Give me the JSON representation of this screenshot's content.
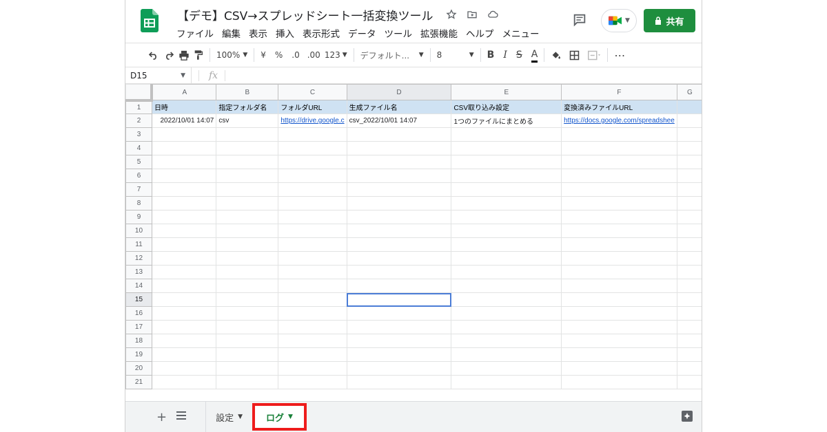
{
  "app": {
    "doc_title": "【デモ】CSV→スプレッドシート一括変換ツール",
    "menu": [
      "ファイル",
      "編集",
      "表示",
      "挿入",
      "表示形式",
      "データ",
      "ツール",
      "拡張機能",
      "ヘルプ",
      "メニュー"
    ],
    "share_label": "共有"
  },
  "toolbar": {
    "zoom": "100%",
    "currency": "¥",
    "percent": "%",
    "dec_decrease": ".0",
    "dec_increase": ".00",
    "number_format": "123",
    "font_name": "デフォルト...",
    "font_size": "8",
    "bold": "B",
    "italic": "I",
    "strike": "S",
    "text_color": "A",
    "more": "⋯"
  },
  "formula_bar": {
    "cell_ref": "D15",
    "fx": "fx",
    "content": ""
  },
  "grid": {
    "columns": [
      "A",
      "B",
      "C",
      "D",
      "E",
      "F",
      "G"
    ],
    "active_column": "D",
    "active_row": 15,
    "row_numbers": [
      "1",
      "2",
      "3",
      "4",
      "5",
      "6",
      "7",
      "8",
      "9",
      "10",
      "11",
      "12",
      "13",
      "14",
      "15",
      "16",
      "17",
      "18",
      "19",
      "20",
      "21"
    ],
    "header_row": [
      "日時",
      "指定フォルダ名",
      "フォルダURL",
      "生成ファイル名",
      "CSV取り込み設定",
      "変換済みファイルURL",
      ""
    ],
    "data_row": [
      "2022/10/01 14:07",
      "csv",
      "https://drive.google.c",
      "csv_2022/10/01 14:07",
      "1つのファイルにまとめる",
      "https://docs.google.com/spreadshee",
      ""
    ]
  },
  "sheet_tabs": {
    "tabs": [
      {
        "label": "設定",
        "active": false
      },
      {
        "label": "ログ",
        "active": true
      }
    ]
  },
  "colors": {
    "header_fill": "#cfe2f3",
    "share_green": "#1e8e3e",
    "active_tab_text": "#188038",
    "highlight_border": "#ee1c1c",
    "selection": "#4a7cd6"
  }
}
